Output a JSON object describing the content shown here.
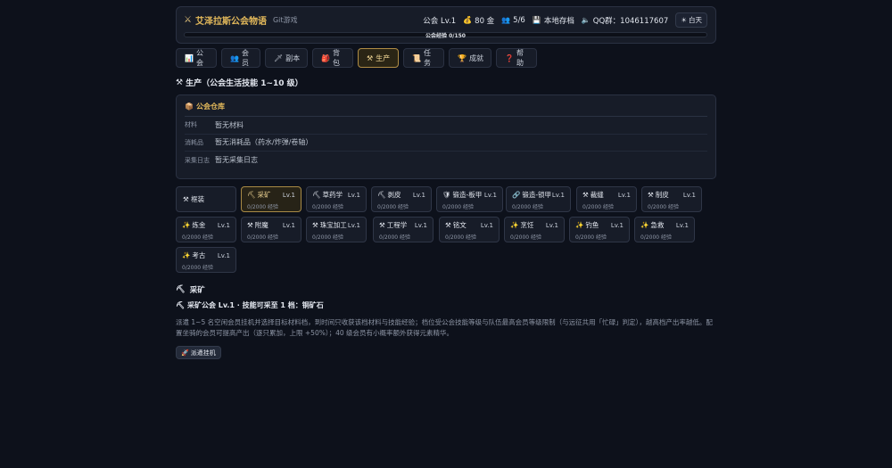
{
  "header": {
    "logo_icon": "crossed-swords-icon",
    "title": "艾泽拉斯公会物语",
    "subtitle": "Git游戏",
    "guild_level": "公会 Lv.1",
    "gold": "80 金",
    "members": "5/6",
    "storage": "本地存档",
    "qq": "QQ群：1046117607",
    "day_button": "白天",
    "xp_label": "公会经验 0/150",
    "xp_fraction": 0
  },
  "tabs": [
    {
      "icon": "📊",
      "label": "公会"
    },
    {
      "icon": "👥",
      "label": "会员"
    },
    {
      "icon": "🗡",
      "label": "副本"
    },
    {
      "icon": "🎒",
      "label": "背包"
    },
    {
      "icon": "⚒",
      "label": "生产",
      "active": true
    },
    {
      "icon": "📜",
      "label": "任务"
    },
    {
      "icon": "🏆",
      "label": "成就"
    },
    {
      "icon": "❓",
      "label": "帮助"
    }
  ],
  "section_title": "生产（公会生活技能 1~10 级）",
  "warehouse": {
    "title": "公会仓库",
    "rows": [
      {
        "key": "材料",
        "value": "暂无材料"
      },
      {
        "key": "消耗品",
        "value": "暂无消耗品（药水/炸弹/卷轴）"
      },
      {
        "key": "采集日志",
        "value": "暂无采集日志"
      }
    ]
  },
  "skill_filter": "框装",
  "skills": [
    {
      "icon": "⛏",
      "name": "采矿",
      "lv": "Lv.1",
      "exp": "0/2000 经验",
      "active": true
    },
    {
      "icon": "⛏",
      "name": "草药学",
      "lv": "Lv.1",
      "exp": "0/2000 经验"
    },
    {
      "icon": "⛏",
      "name": "剥皮",
      "lv": "Lv.1",
      "exp": "0/2000 经验"
    },
    {
      "icon": "🛡",
      "name": "锻造-板甲",
      "lv": "Lv.1",
      "exp": "0/2000 经验"
    },
    {
      "icon": "🔗",
      "name": "锻造-锁甲",
      "lv": "Lv.1",
      "exp": "0/2000 经验"
    },
    {
      "icon": "⚒",
      "name": "裁缝",
      "lv": "Lv.1",
      "exp": "0/2000 经验"
    },
    {
      "icon": "⚒",
      "name": "制皮",
      "lv": "Lv.1",
      "exp": "0/2000 经验"
    },
    {
      "icon": "✨",
      "name": "炼金",
      "lv": "Lv.1",
      "exp": "0/2000 经验"
    },
    {
      "icon": "⚒",
      "name": "附魔",
      "lv": "Lv.1",
      "exp": "0/2000 经验"
    },
    {
      "icon": "⚒",
      "name": "珠宝加工",
      "lv": "Lv.1",
      "exp": "0/2000 经验"
    },
    {
      "icon": "⚒",
      "name": "工程学",
      "lv": "Lv.1",
      "exp": "0/2000 经验"
    },
    {
      "icon": "⚒",
      "name": "铭文",
      "lv": "Lv.1",
      "exp": "0/2000 经验"
    },
    {
      "icon": "✨",
      "name": "烹饪",
      "lv": "Lv.1",
      "exp": "0/2000 经验"
    },
    {
      "icon": "✨",
      "name": "钓鱼",
      "lv": "Lv.1",
      "exp": "0/2000 经验"
    },
    {
      "icon": "✨",
      "name": "急救",
      "lv": "Lv.1",
      "exp": "0/2000 经验"
    },
    {
      "icon": "✨",
      "name": "考古",
      "lv": "Lv.1",
      "exp": "0/2000 经验"
    }
  ],
  "mining": {
    "title": "采矿",
    "subtitle": "采矿公会 Lv.1 · 技能可采至 1 档：铜矿石",
    "description": "派遣 1~5 名空闲会员挂机并选择目标材料档，到时间只收获该档材料与技能经验；档位受公会技能等级与队伍最高会员等级限制（与远征共用「忙碌」判定），越高档产出率越低。配置坐骑的会员可提高产出（逐只累加，上限 +50%）；40 级会员有小概率额外获得元素精华。",
    "dispatch_button": "派遣挂机"
  }
}
